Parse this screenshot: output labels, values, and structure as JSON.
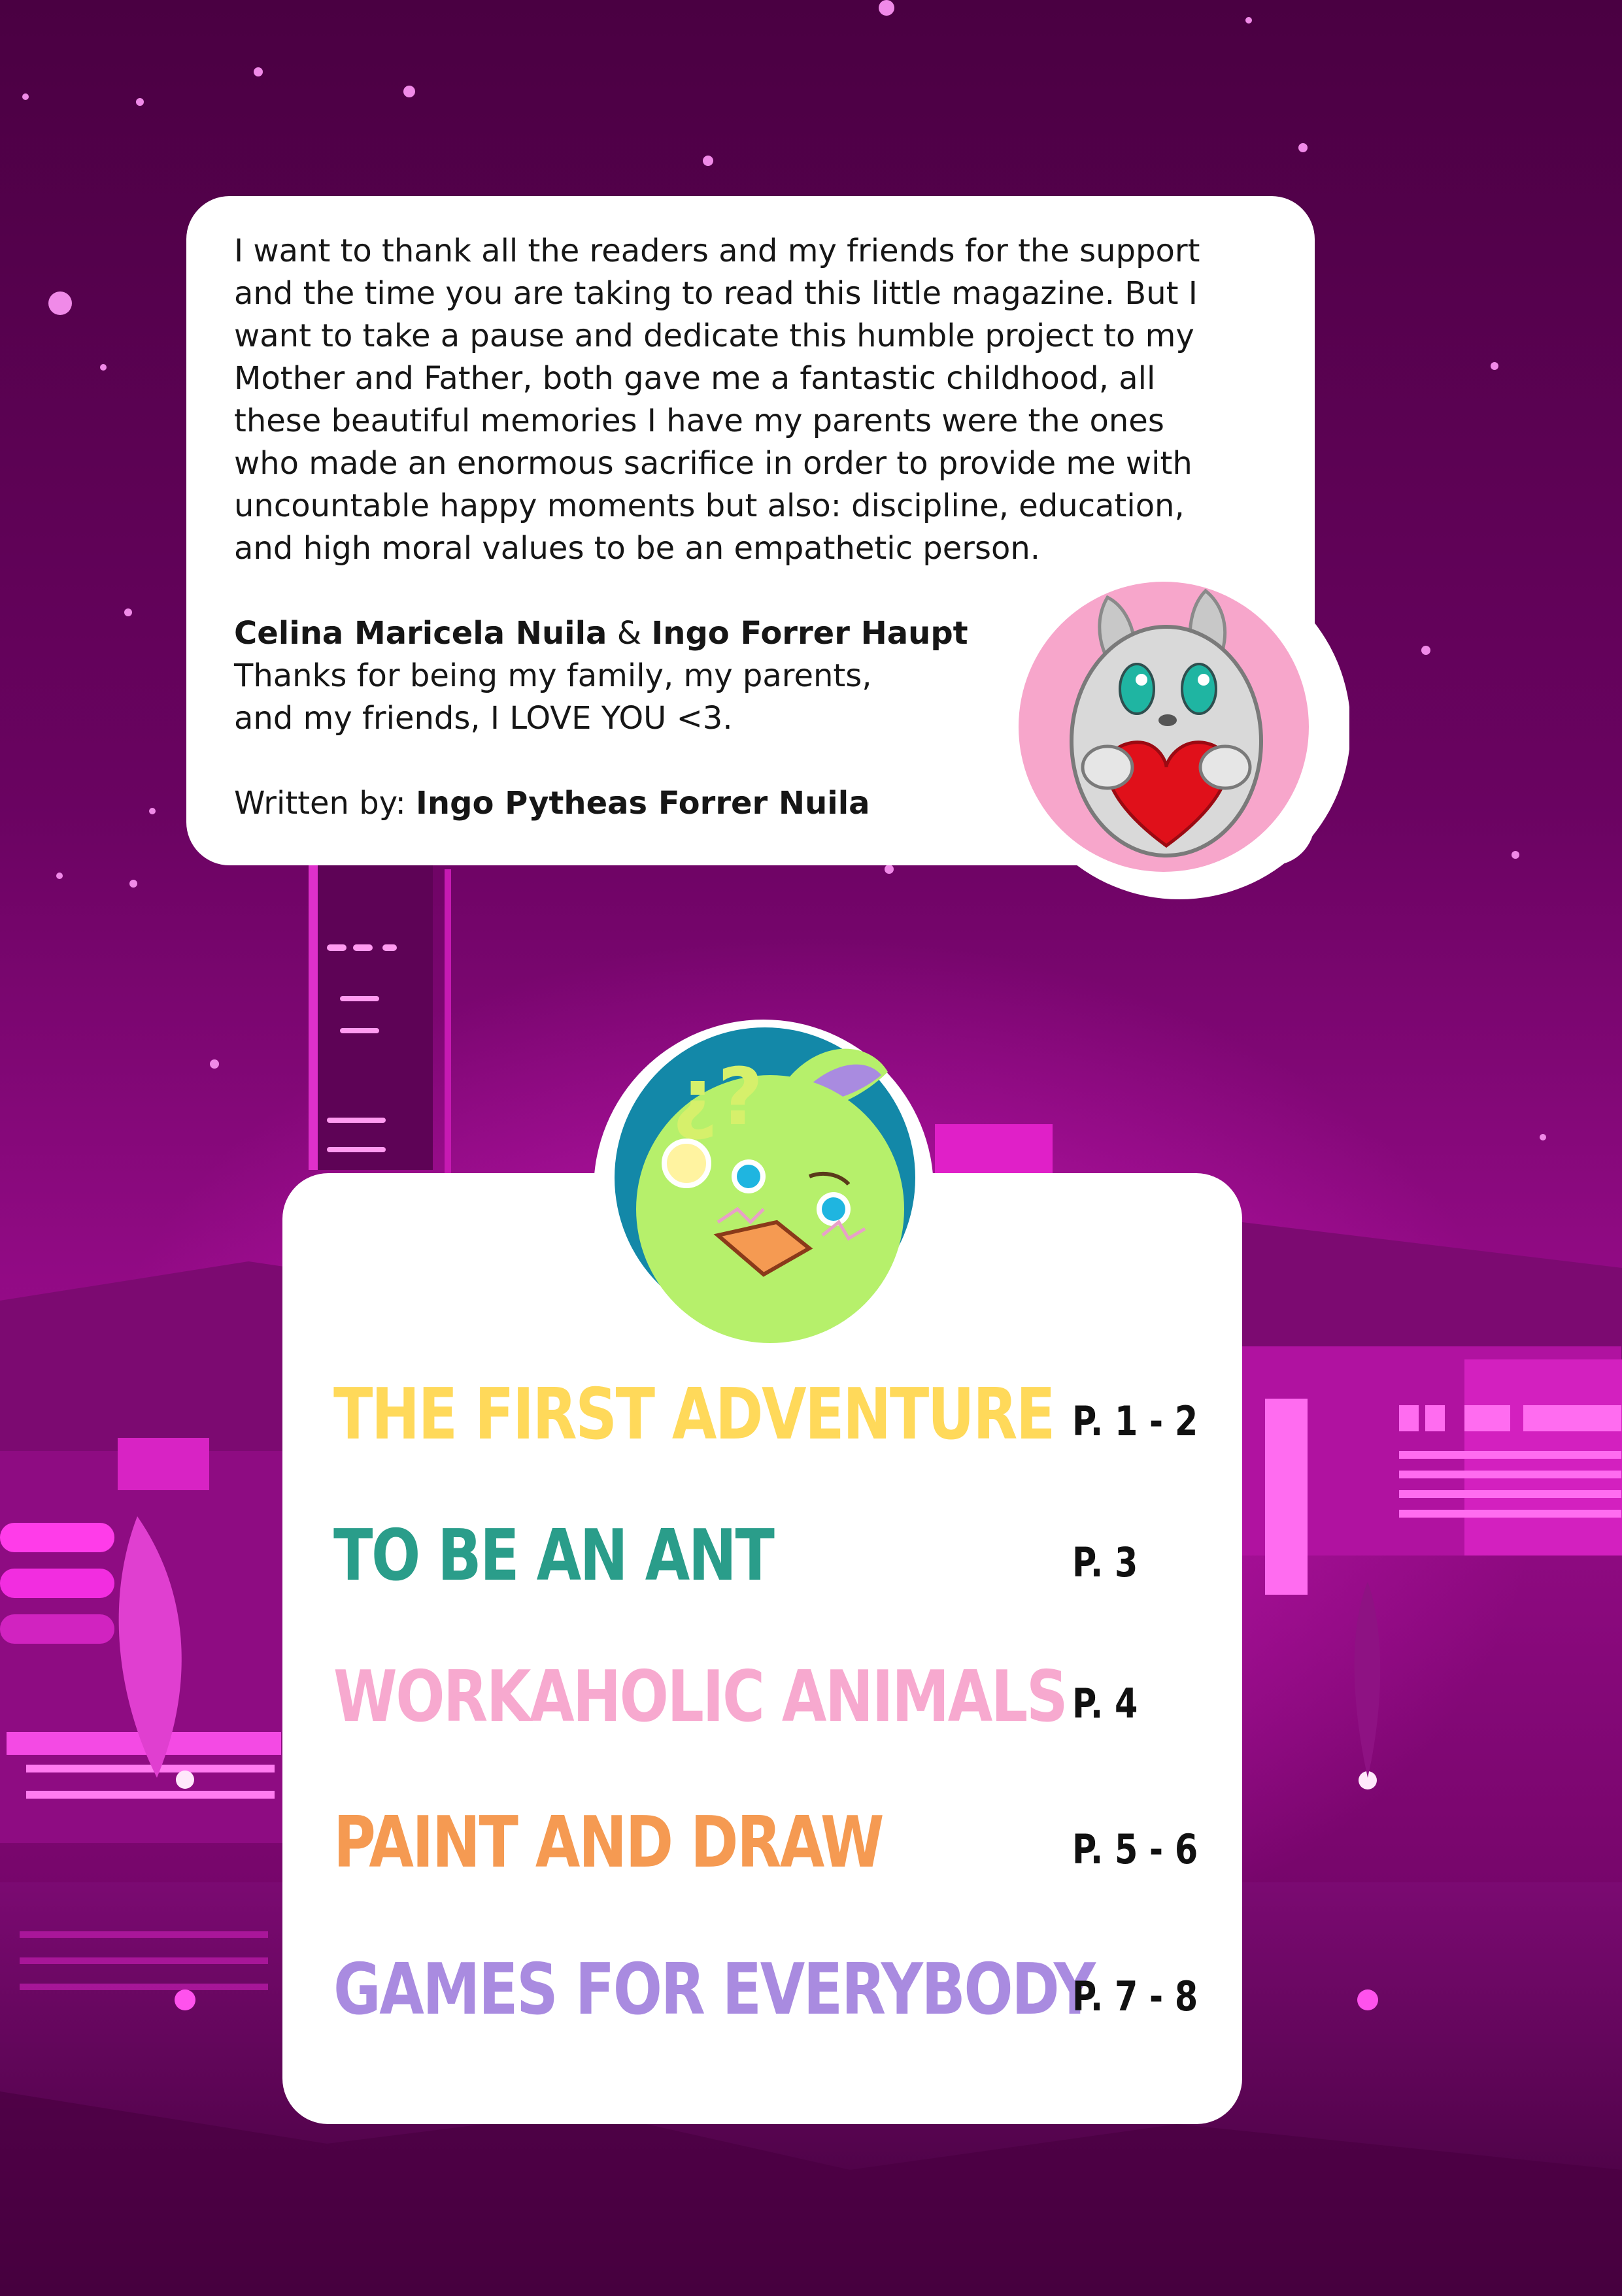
{
  "dedication": {
    "lines": [
      "I want to thank all the readers and my friends for the support",
      "and the time you are taking to read this little magazine. But I",
      "want to take a pause and dedicate this humble project to my",
      "Mother and Father, both gave me a fantastic childhood, all",
      "these beautiful memories I have my parents were the ones",
      "who made an enormous sacrifice in order to provide me with",
      "uncountable happy moments but also: discipline, education,",
      "and high moral values to be an empathetic person."
    ],
    "parent_one": "Celina Maricela Nuila",
    "ampersand": " & ",
    "parent_two": "Ingo Forrer Haupt",
    "thanks_line_1": "Thanks for being my family, my parents,",
    "thanks_line_2": "and my friends, I LOVE YOU <3.",
    "written_by_label": "Written by: ",
    "author": "Ingo Pytheas Forrer Nuila"
  },
  "chick_badge": {
    "text": "¿?"
  },
  "table_of_contents": [
    {
      "title": "THE FIRST ADVENTURE",
      "pages": "P. 1 - 2",
      "color": "#FFD95A"
    },
    {
      "title": "TO BE AN ANT",
      "pages": "P. 3",
      "color": "#2A9D8A"
    },
    {
      "title": "WORKAHOLIC ANIMALS",
      "pages": "P. 4",
      "color": "#F7A9CF"
    },
    {
      "title": "PAINT AND DRAW",
      "pages": "P. 5 - 6",
      "color": "#F59A52"
    },
    {
      "title": "GAMES FOR EVERYBODY",
      "pages": "P. 7 - 8",
      "color": "#A98BE0"
    }
  ],
  "colors": {
    "background_top": "#4A0042",
    "background_glow": "#B0109E",
    "neon": "#FF3CE9"
  }
}
